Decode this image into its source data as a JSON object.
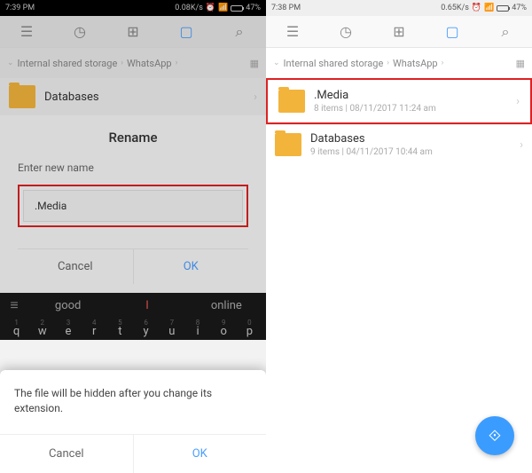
{
  "left": {
    "status": {
      "time": "7:39 PM",
      "speed": "0.08K/s",
      "battery_pct": "47%"
    },
    "breadcrumb": {
      "root": "Internal shared storage",
      "sub": "WhatsApp"
    },
    "folder": {
      "name": "Databases"
    },
    "dialog": {
      "title": "Rename",
      "label": "Enter new name",
      "value": ".Media",
      "cancel": "Cancel",
      "ok": "OK"
    },
    "keyboard": {
      "suggest": [
        "good",
        "I",
        "online"
      ],
      "row1": [
        "q",
        "w",
        "e",
        "r",
        "t",
        "y",
        "u",
        "i",
        "o",
        "p"
      ],
      "nums": [
        "1",
        "2",
        "3",
        "4",
        "5",
        "6",
        "7",
        "8",
        "9",
        "0"
      ]
    },
    "popup": {
      "text": "The file will be hidden after you change its extension.",
      "cancel": "Cancel",
      "ok": "OK"
    }
  },
  "right": {
    "status": {
      "time": "7:38 PM",
      "speed": "0.65K/s",
      "battery_pct": "47%"
    },
    "breadcrumb": {
      "root": "Internal shared storage",
      "sub": "WhatsApp"
    },
    "folders": [
      {
        "name": ".Media",
        "meta": "8 items | 08/11/2017 11:24 am"
      },
      {
        "name": "Databases",
        "meta": "9 items | 04/11/2017 10:44 am"
      }
    ]
  }
}
